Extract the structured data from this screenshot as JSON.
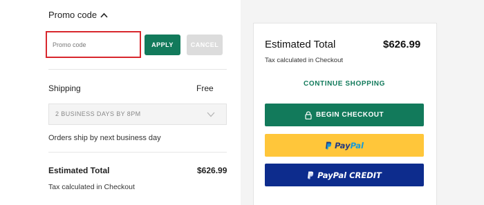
{
  "promo": {
    "heading": "Promo code",
    "input_placeholder": "Promo code",
    "input_value": "",
    "apply_label": "APPLY",
    "cancel_label": "CANCEL"
  },
  "shipping": {
    "label": "Shipping",
    "value": "Free",
    "selected_option": "2 BUSINESS DAYS BY 8PM",
    "note": "Orders ship by next business day"
  },
  "summary_left": {
    "estimated_label": "Estimated Total",
    "estimated_value": "$626.99",
    "tax_note": "Tax calculated in Checkout"
  },
  "summary_card": {
    "estimated_label": "Estimated Total",
    "estimated_value": "$626.99",
    "tax_note": "Tax calculated in Checkout",
    "continue_label": "CONTINUE SHOPPING",
    "checkout_label": "BEGIN CHECKOUT",
    "paypal_pay": "Pay",
    "paypal_pal": "Pal",
    "paypal_credit_label": "PayPal CREDIT"
  },
  "colors": {
    "accent_green": "#127a5b",
    "error_red": "#d8262c",
    "paypal_yellow": "#ffc63a",
    "paypal_credit_blue": "#0d2c8d",
    "panel_gray": "#f4f4f4"
  },
  "icons": {
    "promo_toggle": "chevron-up-icon",
    "shipping_select": "chevron-down-icon",
    "checkout": "lock-icon",
    "paypal": "paypal-logo-icon"
  }
}
